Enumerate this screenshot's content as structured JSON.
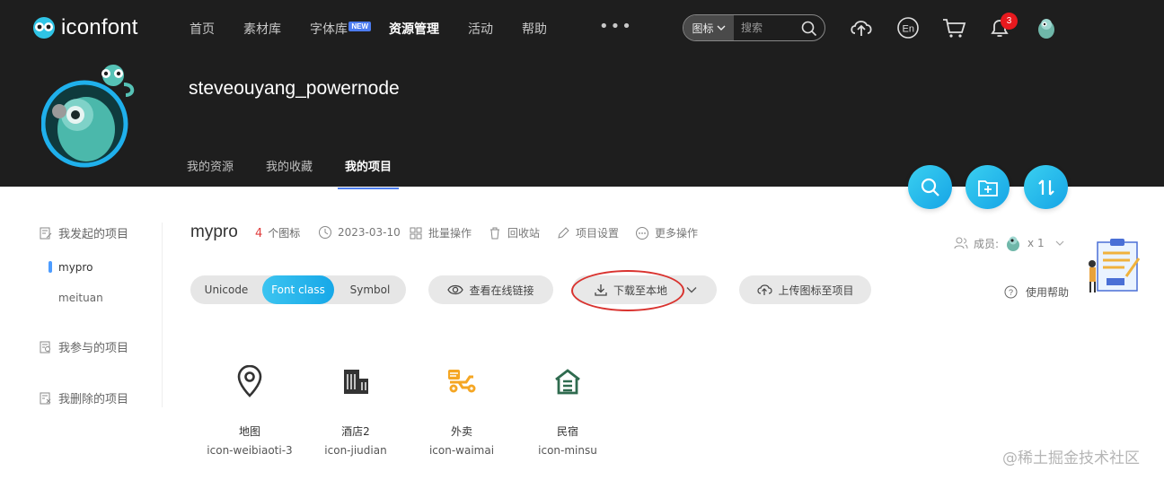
{
  "brand": {
    "name": "iconfont",
    "logo_icon": "chameleon-logo-icon"
  },
  "nav": {
    "items": [
      {
        "label": "首页"
      },
      {
        "label": "素材库"
      },
      {
        "label": "字体库",
        "badge": "NEW"
      },
      {
        "label": "资源管理",
        "active": true
      },
      {
        "label": "活动"
      },
      {
        "label": "帮助"
      }
    ],
    "more": "•••"
  },
  "search": {
    "type_label": "图标",
    "placeholder": "搜索"
  },
  "header_icons": [
    "upload-cloud-icon",
    "language-en-icon",
    "cart-icon",
    "bell-icon",
    "user-avatar-icon"
  ],
  "notifications": {
    "count": "3"
  },
  "profile": {
    "username": "steveouyang_powernode"
  },
  "tabs": [
    {
      "label": "我的资源"
    },
    {
      "label": "我的收藏"
    },
    {
      "label": "我的项目",
      "active": true
    }
  ],
  "fabs": [
    "search-icon",
    "new-folder-icon",
    "sort-icon"
  ],
  "sidebar": {
    "created_title": "我发起的项目",
    "projects": [
      {
        "label": "mypro",
        "active": true
      },
      {
        "label": "meituan"
      }
    ],
    "joined_title": "我参与的项目",
    "deleted_title": "我删除的项目"
  },
  "project": {
    "name": "mypro",
    "icon_count": "4",
    "icon_count_suffix": "个图标",
    "date": "2023-03-10",
    "batch_label": "批量操作",
    "recycle_label": "回收站",
    "settings_label": "项目设置",
    "more_label": "更多操作",
    "members_label": "成员:",
    "members_count": "x 1",
    "help_label": "使用帮助"
  },
  "toggle": {
    "options": [
      {
        "label": "Unicode"
      },
      {
        "label": "Font class",
        "active": true
      },
      {
        "label": "Symbol"
      }
    ]
  },
  "actions": {
    "view_online": "查看在线链接",
    "download": "下载至本地",
    "upload": "上传图标至项目"
  },
  "icons": [
    {
      "name": "地图",
      "code": "icon-weibiaoti-3",
      "icon": "map-pin-icon",
      "color": "#333333"
    },
    {
      "name": "酒店2",
      "code": "icon-jiudian",
      "icon": "hotel-building-icon",
      "color": "#333333"
    },
    {
      "name": "外卖",
      "code": "icon-waimai",
      "icon": "delivery-scooter-icon",
      "color": "#f5a623"
    },
    {
      "name": "民宿",
      "code": "icon-minsu",
      "icon": "homestay-house-icon",
      "color": "#2f6b4f"
    }
  ],
  "watermark": "@稀土掘金技术社区",
  "colors": {
    "header_bg": "#1e1e1e",
    "accent": "#1fb0ec",
    "active_tab_underline": "#4c7cf0",
    "badge_red": "#e8191e",
    "annotation_red": "#d9332f"
  }
}
